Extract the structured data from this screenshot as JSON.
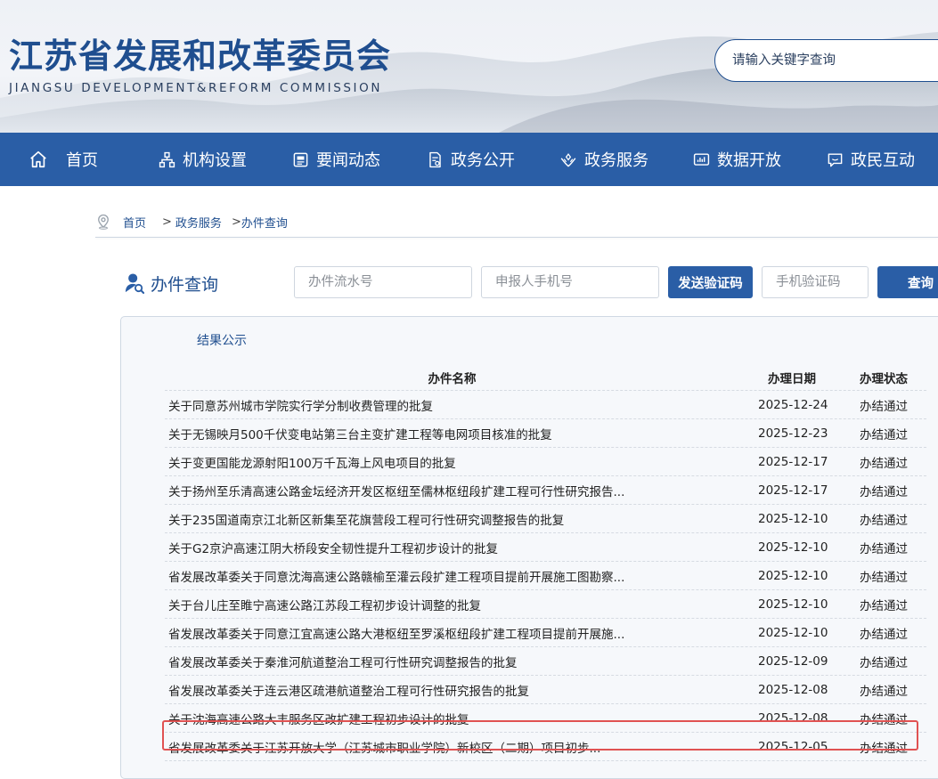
{
  "header": {
    "title": "江苏省发展和改革委员会",
    "subtitle": "JIANGSU DEVELOPMENT&REFORM COMMISSION",
    "search_placeholder": "请输入关键字查询"
  },
  "nav": {
    "items": [
      {
        "label": "首页",
        "icon": "home-icon"
      },
      {
        "label": "机构设置",
        "icon": "org-chart-icon"
      },
      {
        "label": "要闻动态",
        "icon": "news-icon"
      },
      {
        "label": "政务公开",
        "icon": "document-icon"
      },
      {
        "label": "政务服务",
        "icon": "service-hands-icon"
      },
      {
        "label": "数据开放",
        "icon": "data-chart-icon"
      },
      {
        "label": "政民互动",
        "icon": "chat-icon"
      }
    ]
  },
  "breadcrumb": {
    "icon": "location-pin-icon",
    "home": "首页",
    "sep1": ">",
    "level1": "政务服务",
    "sep2": ">",
    "level2": "办件查询"
  },
  "query": {
    "title": "办件查询",
    "icon": "user-search-icon",
    "serial_placeholder": "办件流水号",
    "phone_placeholder": "申报人手机号",
    "send_code_label": "发送验证码",
    "code_placeholder": "手机验证码",
    "submit_label": "查询"
  },
  "results": {
    "title": "结果公示",
    "columns": {
      "name": "办件名称",
      "date": "办理日期",
      "status": "办理状态"
    },
    "rows": [
      {
        "name": "关于同意苏州城市学院实行学分制收费管理的批复",
        "date": "2025-12-24",
        "status": "办结通过"
      },
      {
        "name": "关于无锡映月500千伏变电站第三台主变扩建工程等电网项目核准的批复",
        "date": "2025-12-23",
        "status": "办结通过"
      },
      {
        "name": "关于变更国能龙源射阳100万千瓦海上风电项目的批复",
        "date": "2025-12-17",
        "status": "办结通过"
      },
      {
        "name": "关于扬州至乐清高速公路金坛经济开发区枢纽至儒林枢纽段扩建工程可行性研究报告...",
        "date": "2025-12-17",
        "status": "办结通过"
      },
      {
        "name": "关于235国道南京江北新区新集至花旗营段工程可行性研究调整报告的批复",
        "date": "2025-12-10",
        "status": "办结通过"
      },
      {
        "name": "关于G2京沪高速江阴大桥段安全韧性提升工程初步设计的批复",
        "date": "2025-12-10",
        "status": "办结通过"
      },
      {
        "name": "省发展改革委关于同意沈海高速公路赣榆至灌云段扩建工程项目提前开展施工图勘察...",
        "date": "2025-12-10",
        "status": "办结通过"
      },
      {
        "name": "关于台儿庄至睢宁高速公路江苏段工程初步设计调整的批复",
        "date": "2025-12-10",
        "status": "办结通过"
      },
      {
        "name": "省发展改革委关于同意江宜高速公路大港枢纽至罗溪枢纽段扩建工程项目提前开展施...",
        "date": "2025-12-10",
        "status": "办结通过"
      },
      {
        "name": "省发展改革委关于秦淮河航道整治工程可行性研究调整报告的批复",
        "date": "2025-12-09",
        "status": "办结通过"
      },
      {
        "name": "省发展改革委关于连云港区疏港航道整治工程可行性研究报告的批复",
        "date": "2025-12-08",
        "status": "办结通过"
      },
      {
        "name": "关于沈海高速公路大丰服务区改扩建工程初步设计的批复",
        "date": "2025-12-08",
        "status": "办结通过"
      },
      {
        "name": "省发展改革委关于江苏开放大学（江苏城市职业学院）新校区（二期）项目初步...",
        "date": "2025-12-05",
        "status": "办结通过"
      }
    ]
  },
  "colors": {
    "brand": "#1f4e8f",
    "nav_bg": "#2a5ea6",
    "highlight": "#e05252"
  }
}
